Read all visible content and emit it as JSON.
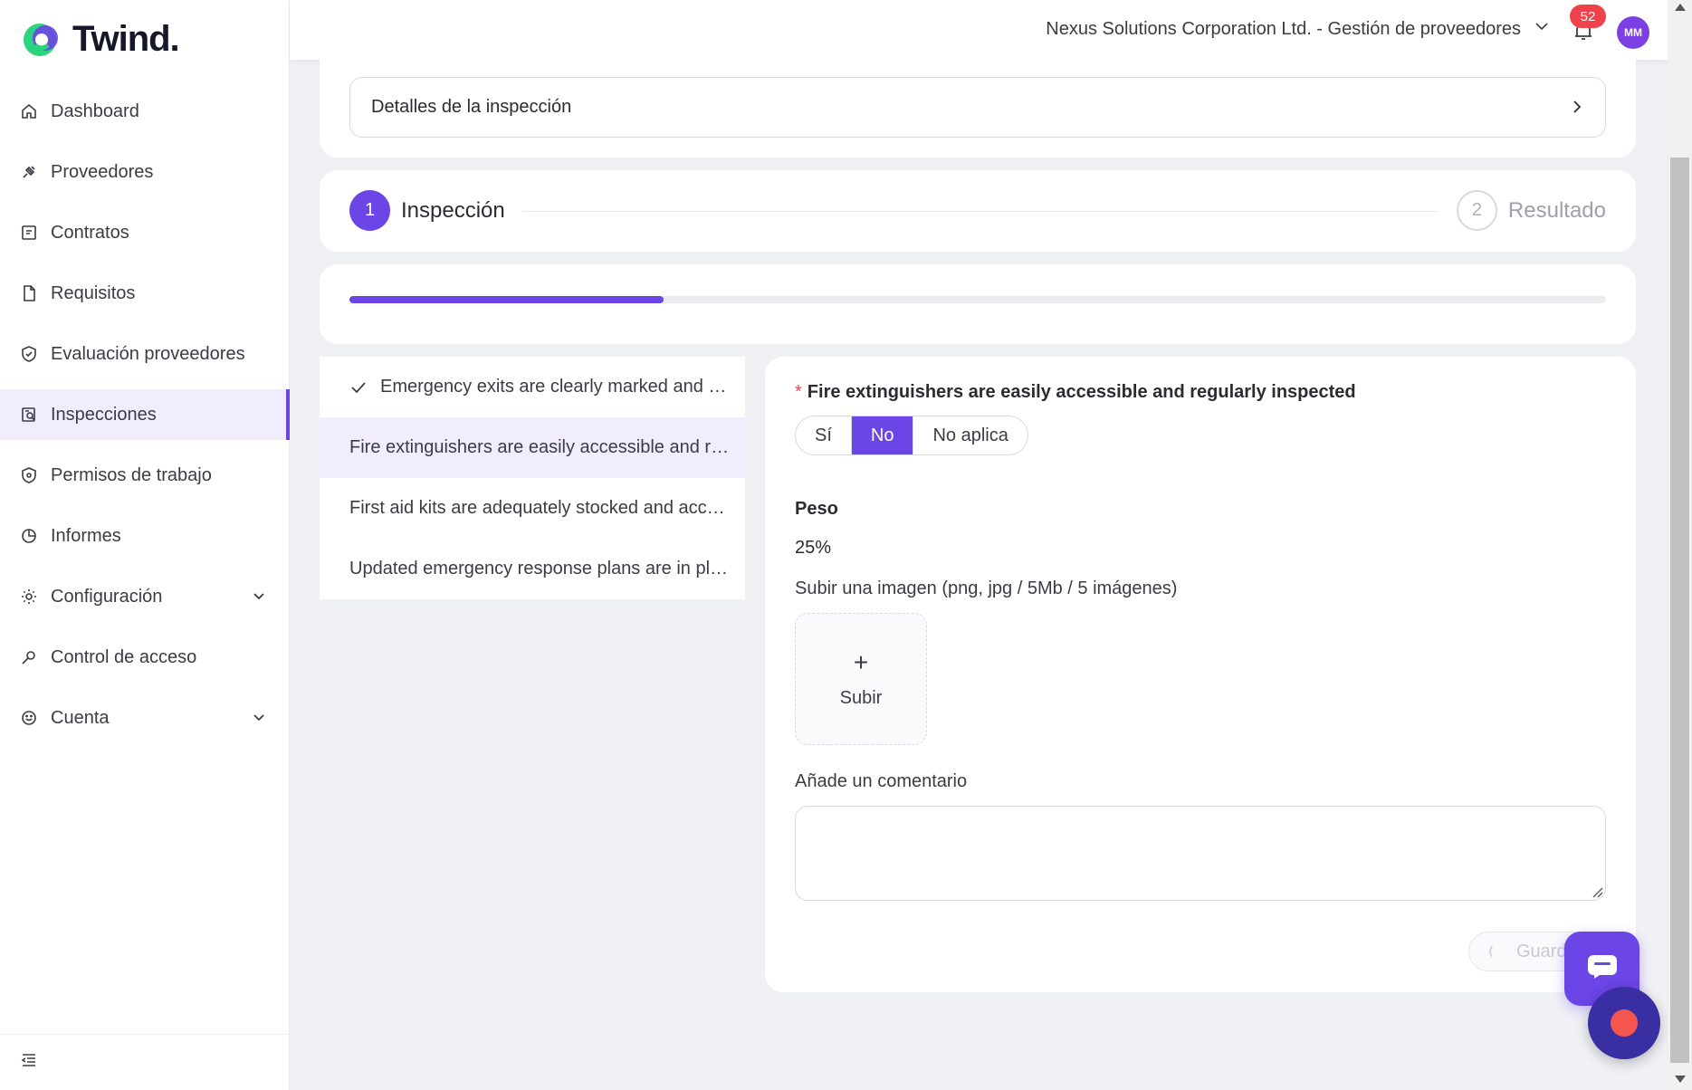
{
  "app": {
    "name": "Twind."
  },
  "sidebar": {
    "items": [
      {
        "label": "Dashboard",
        "icon": "home-icon"
      },
      {
        "label": "Proveedores",
        "icon": "plug-icon"
      },
      {
        "label": "Contratos",
        "icon": "contract-icon"
      },
      {
        "label": "Requisitos",
        "icon": "file-icon"
      },
      {
        "label": "Evaluación proveedores",
        "icon": "shield-check-icon"
      },
      {
        "label": "Inspecciones",
        "icon": "inspection-icon",
        "active": true
      },
      {
        "label": "Permisos de trabajo",
        "icon": "shield-icon"
      },
      {
        "label": "Informes",
        "icon": "pie-chart-icon"
      },
      {
        "label": "Configuración",
        "icon": "gear-icon",
        "expandable": true
      },
      {
        "label": "Control de acceso",
        "icon": "key-icon"
      },
      {
        "label": "Cuenta",
        "icon": "smile-icon",
        "expandable": true
      }
    ],
    "collapse_icon": "menu-collapse-icon"
  },
  "topbar": {
    "organization": "Nexus Solutions Corporation Ltd. - Gestión de proveedores",
    "notifications_count": "52",
    "avatar_initials": "MM"
  },
  "details": {
    "label": "Detalles de la inspección"
  },
  "steps": [
    {
      "number": "1",
      "label": "Inspección",
      "active": true
    },
    {
      "number": "2",
      "label": "Resultado",
      "active": false
    }
  ],
  "progress": {
    "fraction": 0.25
  },
  "questions": [
    {
      "text": "Emergency exits are clearly marked and unobstructed",
      "done": true
    },
    {
      "text": "Fire extinguishers are easily accessible and regularly inspected",
      "active": true
    },
    {
      "text": "First aid kits are adequately stocked and accessible"
    },
    {
      "text": "Updated emergency response plans are in place"
    }
  ],
  "current_question": {
    "title": "Fire extinguishers are easily accessible and regularly inspected",
    "required_mark": "*",
    "options": [
      "Sí",
      "No",
      "No aplica"
    ],
    "selected": "No",
    "peso_label": "Peso",
    "peso_value": "25%",
    "upload_label": "Subir una imagen (png, jpg / 5Mb / 5 imágenes)",
    "upload_plus": "+",
    "upload_button": "Subir",
    "comment_label": "Añade un comentario",
    "comment_value": "",
    "save_label": "Guardar"
  },
  "colors": {
    "accent": "#6b45e6",
    "badge": "#f0424a",
    "record": "#f4564f"
  }
}
